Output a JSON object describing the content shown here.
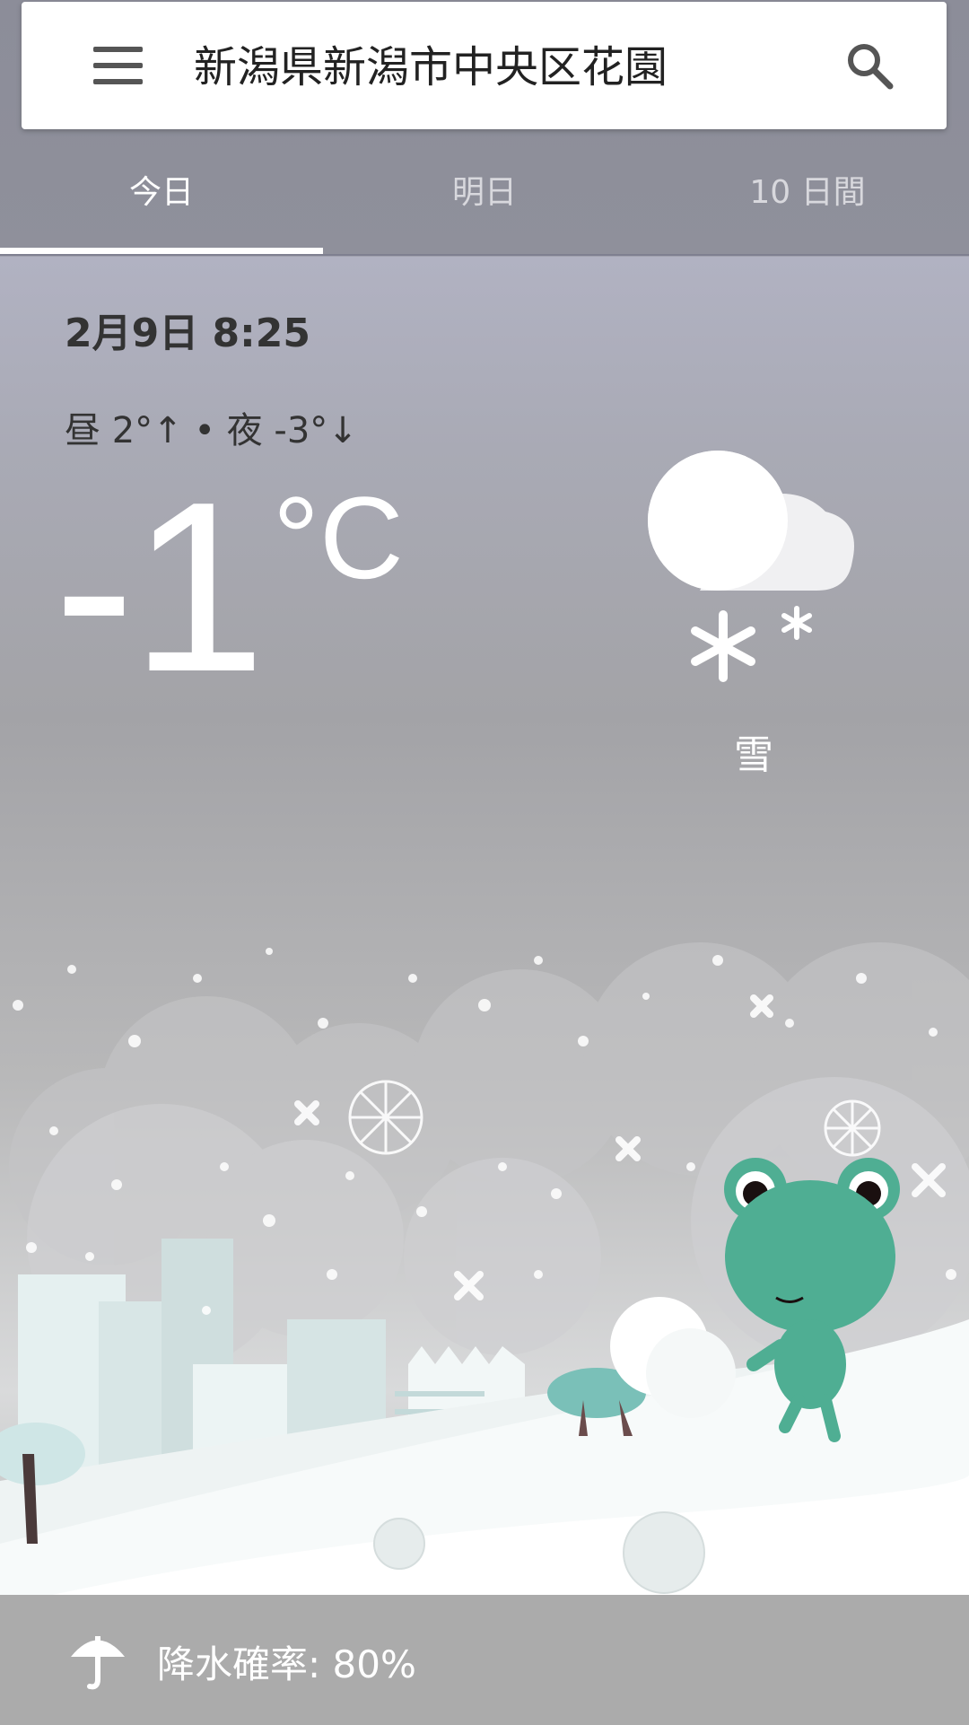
{
  "search": {
    "location": "新潟県新潟市中央区花園",
    "menu_icon": "menu-icon",
    "search_icon": "search-icon"
  },
  "tabs": [
    {
      "label": "今日",
      "active": true
    },
    {
      "label": "明日",
      "active": false
    },
    {
      "label": "10 日間",
      "active": false
    }
  ],
  "weather": {
    "datetime": "2月9日 8:25",
    "day_night": "昼 2°↑ • 夜 -3°↓",
    "temperature": "-1",
    "unit": "°C",
    "condition": "雪",
    "condition_icon": "snow-icon"
  },
  "precipitation": {
    "icon": "umbrella-icon",
    "text": "降水確率: 80%"
  },
  "colors": {
    "header_bg": "#8c8d99",
    "tab_active": "#ffffff",
    "tab_inactive": "#d8d8dd",
    "frog": "#4fae93",
    "bottom_bar": "#ababab"
  }
}
